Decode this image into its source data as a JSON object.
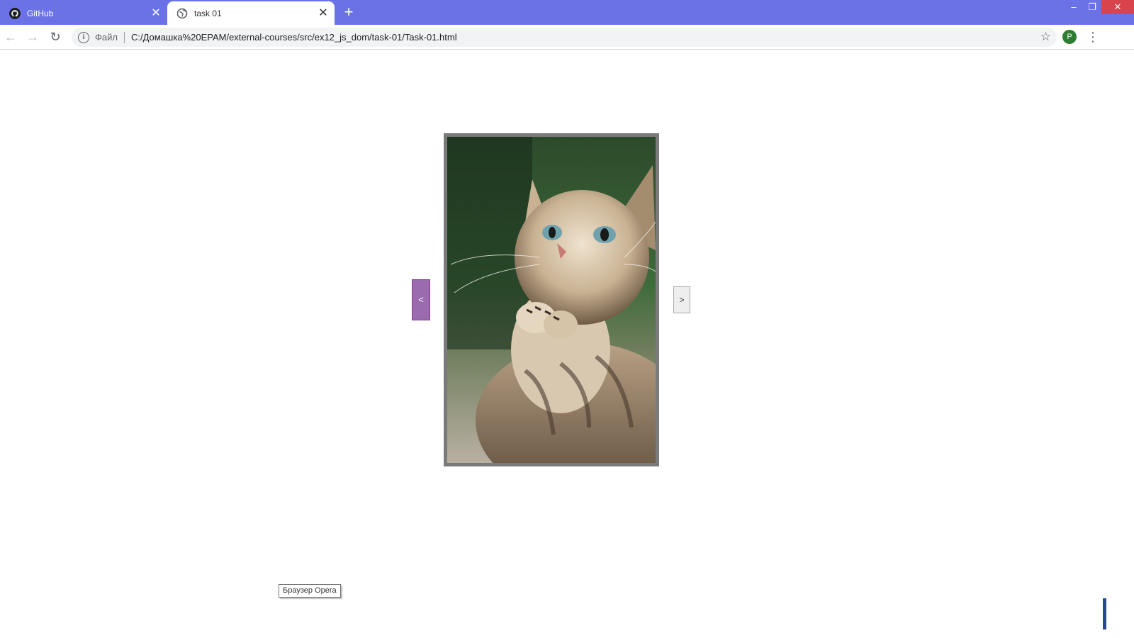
{
  "browser": {
    "tabs": [
      {
        "title": "GitHub",
        "icon": "github-icon",
        "active": false
      },
      {
        "title": "task 01",
        "icon": "globe-icon",
        "active": true
      }
    ],
    "new_tab_label": "+",
    "window_controls": {
      "minimize": "–",
      "restore": "❐",
      "close": "✕"
    }
  },
  "toolbar": {
    "back": "←",
    "forward": "→",
    "reload": "↻",
    "info": "i",
    "scheme_label": "Файл",
    "url": "C:/Домашка%20EPAM/external-courses/src/ex12_js_dom/task-01/Task-01.html",
    "star": "☆",
    "profile_initial": "P",
    "menu": "⋮"
  },
  "page": {
    "prev_label": "<",
    "next_label": ">",
    "image_subject": "kitten with raised paws",
    "tooltip": "Браузер Opera"
  },
  "colors": {
    "tabstrip": "#6b72e6",
    "prev_button": "#9b6bb0",
    "frame": "#7a7a7a",
    "profile": "#2e7d32"
  }
}
